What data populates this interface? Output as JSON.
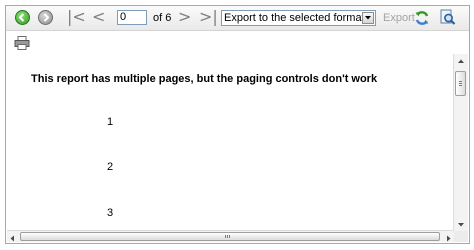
{
  "toolbar": {
    "page_value": "0",
    "of_pages": "of 6",
    "export_select": "Export to the selected format",
    "export_link": "Export",
    "icons": [
      "back-icon",
      "forward-icon",
      "first-page-icon",
      "previous-page-icon",
      "next-page-icon",
      "last-page-icon",
      "refresh-icon",
      "find-icon"
    ]
  },
  "report": {
    "title": "This report has multiple pages, but the paging controls don't work",
    "rows": [
      "1",
      "2",
      "3"
    ]
  }
}
